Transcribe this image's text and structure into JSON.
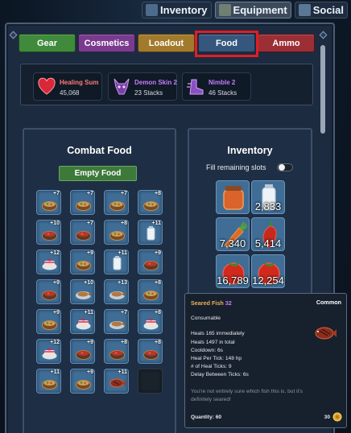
{
  "nav": {
    "tabs": [
      {
        "label": "Inventory",
        "icon": "backpack-icon"
      },
      {
        "label": "Equipment",
        "icon": "armor-icon"
      },
      {
        "label": "Social",
        "icon": "people-icon"
      }
    ],
    "active": "Equipment"
  },
  "categories": [
    {
      "label": "Gear",
      "color": "#3f8a3b"
    },
    {
      "label": "Cosmetics",
      "color": "#7a3b8e"
    },
    {
      "label": "Loadout",
      "color": "#a27a2c"
    },
    {
      "label": "Food",
      "color": "#35577e"
    },
    {
      "label": "Ammo",
      "color": "#9c2f36"
    }
  ],
  "buffs": [
    {
      "name": "Healing Sum",
      "value": "45,068",
      "name_color": "#ff7a7a",
      "icon": "heart-icon"
    },
    {
      "name": "Demon Skin 2",
      "value": "23 Stacks",
      "name_color": "#c57dff",
      "icon": "demon-mask-icon"
    },
    {
      "name": "Nimble 2",
      "value": "46 Stacks",
      "name_color": "#c57dff",
      "icon": "boot-icon"
    }
  ],
  "combat": {
    "title": "Combat Food",
    "empty_button": "Empty Food",
    "slots": [
      {
        "n": "+7",
        "f": "hotpot"
      },
      {
        "n": "+7",
        "f": "hotpot"
      },
      {
        "n": "+7",
        "f": "hotpot"
      },
      {
        "n": "+8",
        "f": "hotpot"
      },
      {
        "n": "+10",
        "f": "tomato-stew"
      },
      {
        "n": "+7",
        "f": "tomato-stew"
      },
      {
        "n": "+8",
        "f": "hotpot"
      },
      {
        "n": "+11",
        "f": "milk"
      },
      {
        "n": "+12",
        "f": "cake"
      },
      {
        "n": "+9",
        "f": "hotpot"
      },
      {
        "n": "+11",
        "f": "milk"
      },
      {
        "n": "+9",
        "f": "tomato-stew"
      },
      {
        "n": "+9",
        "f": "tomato-stew"
      },
      {
        "n": "+10",
        "f": "fish-plate"
      },
      {
        "n": "+13",
        "f": "fish-plate"
      },
      {
        "n": "+8",
        "f": "hotpot"
      },
      {
        "n": "+9",
        "f": "hotpot"
      },
      {
        "n": "+11",
        "f": "cake"
      },
      {
        "n": "+7",
        "f": "fish-plate"
      },
      {
        "n": "+8",
        "f": "cake"
      },
      {
        "n": "+12",
        "f": "cake"
      },
      {
        "n": "+9",
        "f": "tomato-stew"
      },
      {
        "n": "+8",
        "f": "tomato-stew"
      },
      {
        "n": "+8",
        "f": "tomato-stew"
      },
      {
        "n": "+11",
        "f": "hotpot"
      },
      {
        "n": "+9",
        "f": "hotpot"
      },
      {
        "n": "+11",
        "f": "seared-fish"
      },
      {
        "n": "",
        "f": ""
      }
    ]
  },
  "inventory": {
    "title": "Inventory",
    "fill_label": "Fill remaining slots",
    "fill_enabled": false,
    "items": [
      {
        "count": "",
        "f": "honey-jar"
      },
      {
        "count": "2,833",
        "f": "milk-bottle"
      },
      {
        "count": "7,340",
        "f": "carrot"
      },
      {
        "count": "5,414",
        "f": "pepper"
      },
      {
        "count": "16,789",
        "f": "tomato"
      },
      {
        "count": "12,254",
        "f": "tomato"
      }
    ]
  },
  "tooltip": {
    "title": "Seared Fish",
    "level": "32",
    "rarity": "Common",
    "type": "Consumable",
    "stats": [
      "Heals 165 immediately",
      "Heals 1497 in total",
      "Cooldown: 6s",
      "Heal Per Tick: 148 hp",
      "# of Heal Ticks: 9",
      "Delay Between Ticks: 6s"
    ],
    "flavor": [
      "You're not entirely sure which fish this is, but it's",
      "definitely seared!"
    ],
    "quantity": "Quantity: 60",
    "price": "30",
    "icon": "seared-fish-icon",
    "coin_icon": "coin-icon"
  }
}
